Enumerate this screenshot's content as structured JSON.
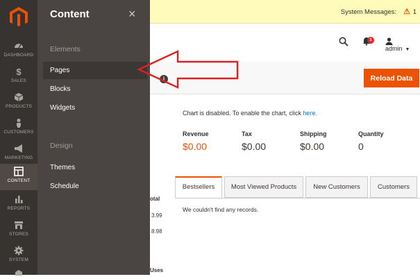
{
  "nav": {
    "items": [
      {
        "label": "DASHBOARD",
        "icon": "dashboard-icon"
      },
      {
        "label": "SALES",
        "icon": "dollar-icon"
      },
      {
        "label": "PRODUCTS",
        "icon": "cube-icon"
      },
      {
        "label": "CUSTOMERS",
        "icon": "person-icon"
      },
      {
        "label": "MARKETING",
        "icon": "megaphone-icon"
      },
      {
        "label": "CONTENT",
        "icon": "layout-icon"
      },
      {
        "label": "REPORTS",
        "icon": "bar-chart-icon"
      },
      {
        "label": "STORES",
        "icon": "store-icon"
      },
      {
        "label": "SYSTEM",
        "icon": "gear-icon"
      }
    ],
    "active": "CONTENT"
  },
  "panel": {
    "title": "Content",
    "close": "×",
    "section_elements": "Elements",
    "elements": [
      "Pages",
      "Blocks",
      "Widgets"
    ],
    "section_design": "Design",
    "design": [
      "Themes",
      "Schedule"
    ]
  },
  "sysbar": {
    "text": "System Messages:",
    "count": "1"
  },
  "header": {
    "notifications": "1",
    "user": "admin"
  },
  "actions": {
    "reload": "Reload Data"
  },
  "chart": {
    "message": "Chart is disabled. To enable the chart, click",
    "link": "here."
  },
  "stats": [
    {
      "label": "Revenue",
      "value": "$0.00"
    },
    {
      "label": "Tax",
      "value": "$0.00"
    },
    {
      "label": "Shipping",
      "value": "$0.00"
    },
    {
      "label": "Quantity",
      "value": "0"
    }
  ],
  "tabs": [
    "Bestsellers",
    "Most Viewed Products",
    "New Customers",
    "Customers"
  ],
  "no_records": "We couldn't find any records.",
  "fragments": {
    "total": "otal",
    "v1": "3.99",
    "v2": "8.98",
    "uses": "Uses"
  },
  "colors": {
    "accent": "#eb5202",
    "nav_bg": "#373330",
    "panel_bg": "#4a4542",
    "arrow": "#e02020"
  }
}
